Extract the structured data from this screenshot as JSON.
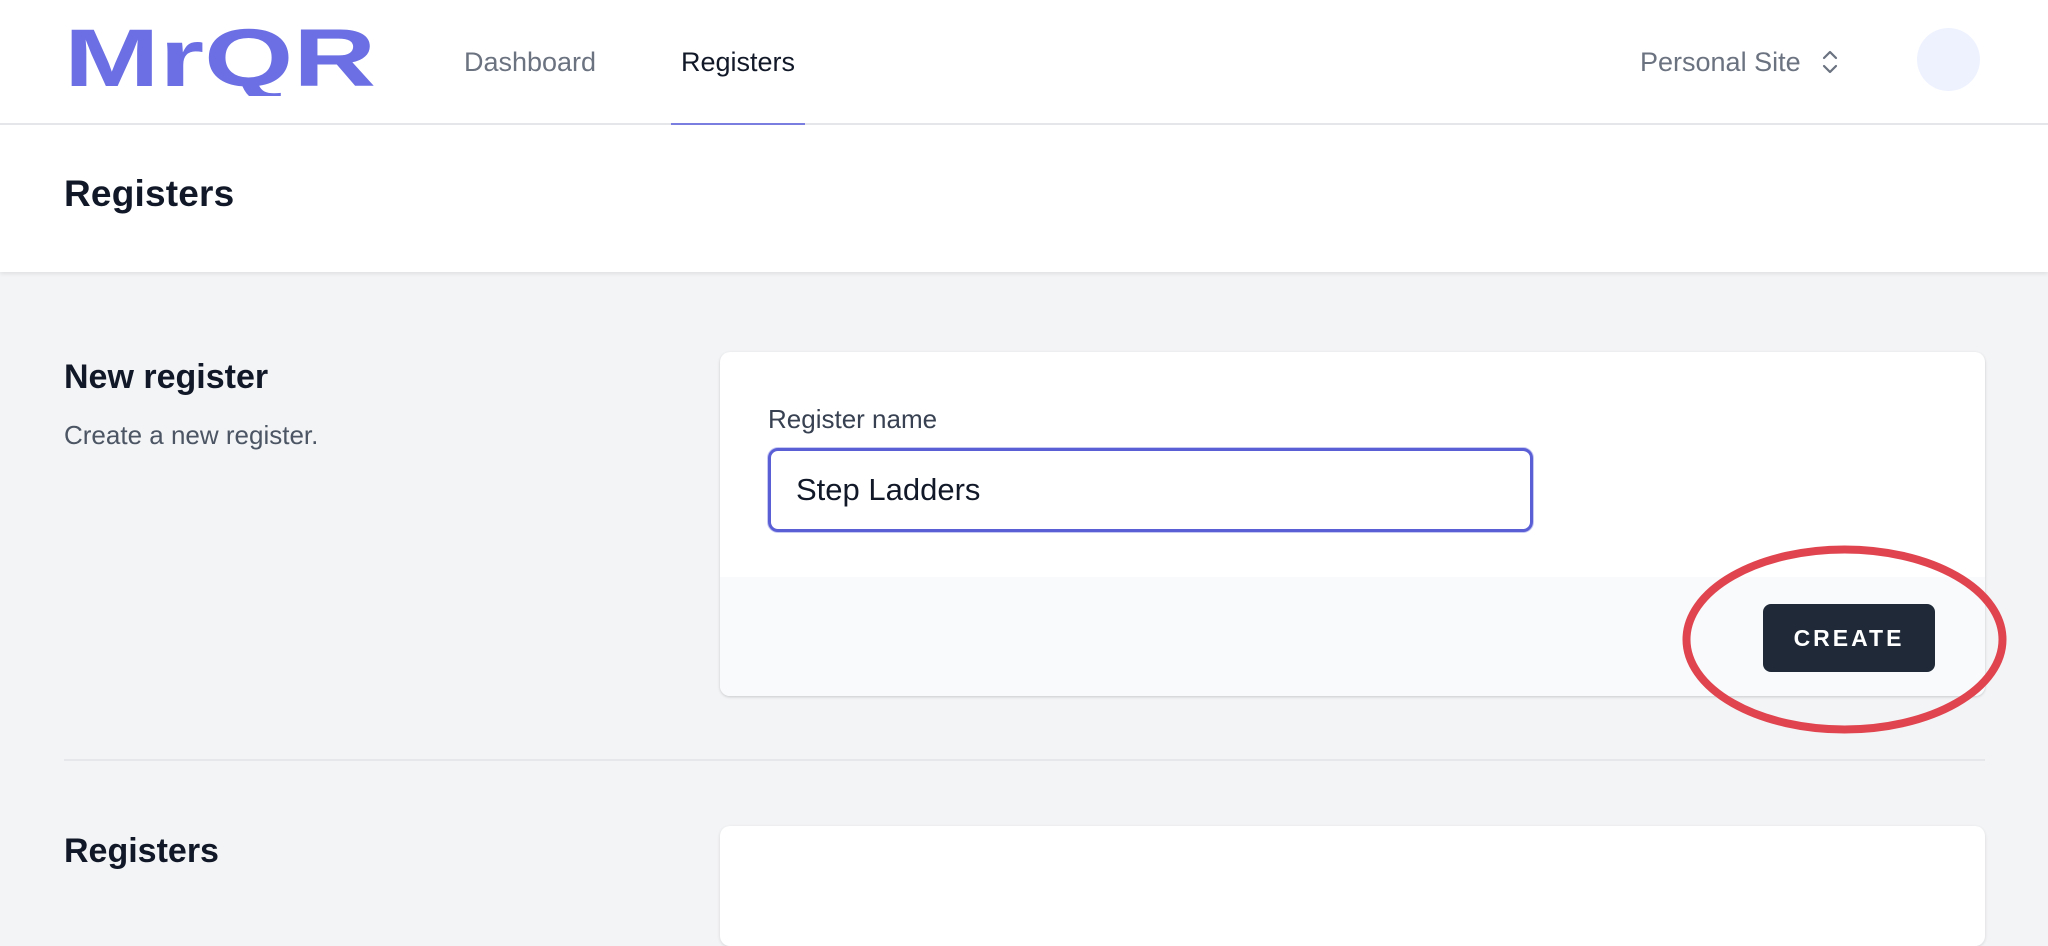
{
  "app": {
    "logo_text": "MrQR",
    "brand_color": "#6b6fe3"
  },
  "nav": {
    "items": [
      {
        "label": "Dashboard",
        "active": false
      },
      {
        "label": "Registers",
        "active": true
      }
    ],
    "site_switcher": {
      "label": "Personal Site",
      "icon": "chevron-up-down-icon"
    },
    "avatar": {
      "icon": "avatar"
    }
  },
  "page": {
    "title": "Registers"
  },
  "new_register": {
    "title": "New register",
    "description": "Create a new register.",
    "field_label": "Register name",
    "field_value": "Step Ladders",
    "submit_label": "CREATE",
    "highlight_color": "#e0444e"
  },
  "registers_section": {
    "title": "Registers"
  }
}
